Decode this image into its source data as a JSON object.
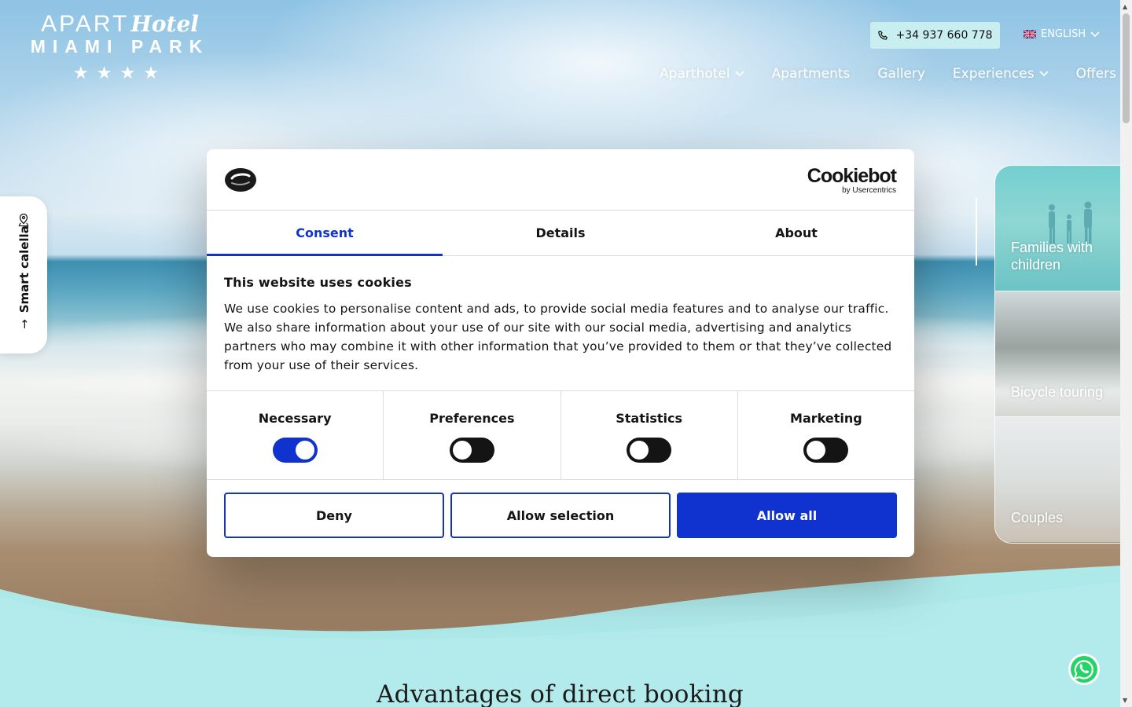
{
  "logo": {
    "line1_plain": "APART",
    "line1_script": "Hotel",
    "line2": "MIAMI PARK",
    "stars": "★★★★"
  },
  "header": {
    "phone": "+34 937 660 778",
    "language": "ENGLISH",
    "nav": [
      "Aparthotel",
      "Apartments",
      "Gallery",
      "Experiences",
      "Offers"
    ]
  },
  "smart_tab": {
    "label": "Smart calella"
  },
  "experiences": [
    {
      "label": "Families with children"
    },
    {
      "label": "Bicycle touring"
    },
    {
      "label": "Couples"
    }
  ],
  "section": {
    "title": "Advantages of direct booking"
  },
  "cookie": {
    "brand": "Cookiebot",
    "brand_by": "by Usercentrics",
    "tabs": [
      "Consent",
      "Details",
      "About"
    ],
    "title": "This website uses cookies",
    "text": "We use cookies to personalise content and ads, to provide social media features and to analyse our traffic. We also share information about your use of our site with our social media, advertising and analytics partners who may combine it with other information that you’ve provided to them or that they’ve collected from your use of their services.",
    "toggles": [
      {
        "label": "Necessary",
        "on": true
      },
      {
        "label": "Preferences",
        "on": false
      },
      {
        "label": "Statistics",
        "on": false
      },
      {
        "label": "Marketing",
        "on": false
      }
    ],
    "buttons": {
      "deny": "Deny",
      "selection": "Allow selection",
      "all": "Allow all"
    }
  },
  "colors": {
    "accent": "#1032cf",
    "phone_bg": "#c9eef0",
    "wave": "#aee9ea",
    "whatsapp": "#25d366"
  }
}
